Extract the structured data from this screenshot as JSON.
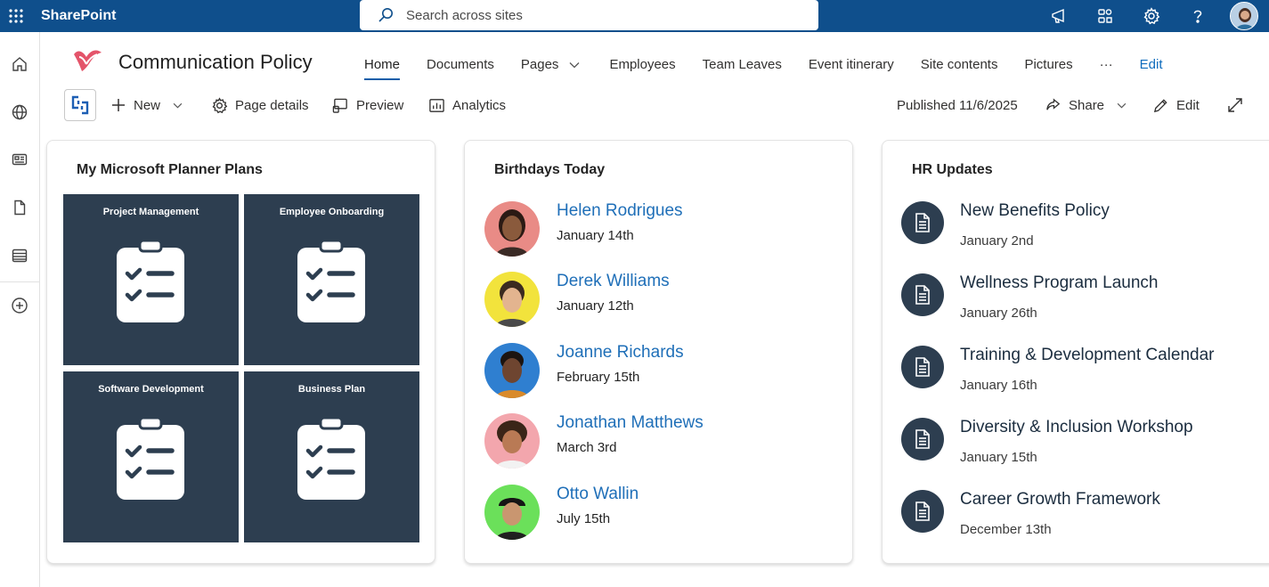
{
  "suitebar": {
    "app_name": "SharePoint",
    "search_placeholder": "Search across sites",
    "bg_color": "#0f4f8c",
    "icons": [
      "waffle-icon",
      "megaphone-icon",
      "app-switch-icon",
      "gear-icon",
      "help-icon"
    ]
  },
  "rail": {
    "items": [
      "home-icon",
      "globe-icon",
      "news-icon",
      "document-icon",
      "list-icon",
      "add-icon"
    ]
  },
  "site": {
    "title": "Communication Policy"
  },
  "nav": {
    "items": [
      {
        "label": "Home",
        "active": true
      },
      {
        "label": "Documents"
      },
      {
        "label": "Pages",
        "dropdown": true
      },
      {
        "label": "Employees"
      },
      {
        "label": "Team Leaves"
      },
      {
        "label": "Event itinerary"
      },
      {
        "label": "Site contents"
      },
      {
        "label": "Pictures"
      },
      {
        "label": "···"
      },
      {
        "label": "Edit"
      }
    ]
  },
  "commandbar": {
    "new_label": "New",
    "page_details_label": "Page details",
    "preview_label": "Preview",
    "analytics_label": "Analytics",
    "published_label": "Published 11/6/2025",
    "share_label": "Share",
    "edit_label": "Edit"
  },
  "planner": {
    "title": "My Microsoft Planner Plans",
    "tile_color": "#2d3e50",
    "plans": [
      {
        "name": "Project Management"
      },
      {
        "name": "Employee Onboarding"
      },
      {
        "name": "Software Development"
      },
      {
        "name": "Business Plan"
      }
    ]
  },
  "birthdays": {
    "title": "Birthdays Today",
    "people": [
      {
        "name": "Helen Rodrigues",
        "date": "January 14th",
        "bg": "#e98b86"
      },
      {
        "name": "Derek Williams",
        "date": "January 12th",
        "bg": "#f2e33c"
      },
      {
        "name": "Joanne Richards",
        "date": "February 15th",
        "bg": "#2f7fd0"
      },
      {
        "name": "Jonathan Matthews",
        "date": "March 3rd",
        "bg": "#f3a6ad"
      },
      {
        "name": "Otto Wallin",
        "date": "July 15th",
        "bg": "#6be05a"
      }
    ]
  },
  "hr_updates": {
    "title": "HR Updates",
    "items": [
      {
        "title": "New Benefits Policy",
        "date": "January 2nd"
      },
      {
        "title": "Wellness Program Launch",
        "date": "January 26th"
      },
      {
        "title": "Training & Development Calendar",
        "date": "January 16th"
      },
      {
        "title": "Diversity & Inclusion Workshop",
        "date": "January 15th"
      },
      {
        "title": "Career Growth Framework",
        "date": "December 13th"
      }
    ]
  }
}
